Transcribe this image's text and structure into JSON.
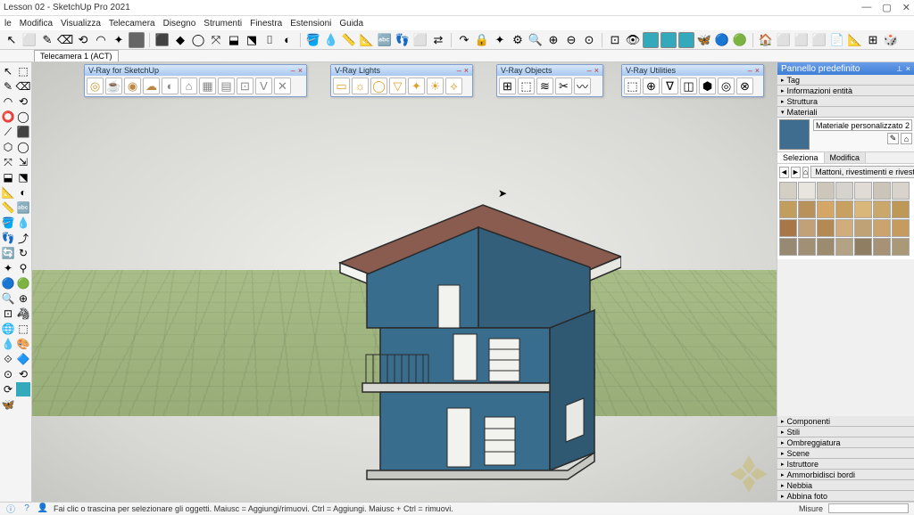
{
  "title": "Lesson 02 - SketchUp Pro 2021",
  "win_controls": {
    "min": "—",
    "max": "▢",
    "close": "✕"
  },
  "menu": [
    "le",
    "Modifica",
    "Visualizza",
    "Telecamera",
    "Disegno",
    "Strumenti",
    "Finestra",
    "Estensioni",
    "Guida"
  ],
  "scene_tab": "Telecamera 1 (ACT)",
  "status": {
    "msg": "Fai clic o trascina per selezionare gli oggetti. Maiusc = Aggiungi/rimuovi. Ctrl = Aggiungi. Maiusc + Ctrl = rimuovi.",
    "measure_label": "Misure"
  },
  "toolbox": {
    "vray_sketchup": {
      "title": "V-Ray for SketchUp"
    },
    "vray_lights": {
      "title": "V-Ray Lights"
    },
    "vray_objects": {
      "title": "V-Ray Objects"
    },
    "vray_utilities": {
      "title": "V-Ray Utilities"
    }
  },
  "right": {
    "pannello": "Pannello predefinito",
    "trays": {
      "tag": "Tag",
      "info": "Informazioni entità",
      "struttura": "Struttura",
      "materiali": "Materiali",
      "componenti": "Componenti",
      "stili": "Stili",
      "ombre": "Ombreggiatura",
      "scene": "Scene",
      "istruttore": "Istruttore",
      "ammorbidisci": "Ammorbidisci bordi",
      "nebbia": "Nebbia",
      "abbina": "Abbina foto"
    },
    "material_name": "Materiale personalizzato 2",
    "tabs": {
      "seleziona": "Seleziona",
      "modifica": "Modifica"
    },
    "collection": "Mattoni, rivestimenti e rivestime",
    "swatches": [
      "#d4cfc4",
      "#e8e5df",
      "#cdc6bb",
      "#d6d3ce",
      "#e0dcd5",
      "#cac4b9",
      "#d9d4cb",
      "#c19d5e",
      "#b8925a",
      "#d4a767",
      "#c8a060",
      "#d9b679",
      "#caa86c",
      "#bd9856",
      "#a87748",
      "#c2a178",
      "#b38954",
      "#d0ad7a",
      "#bfa275",
      "#cba36c",
      "#c69b60",
      "#988972",
      "#a29074",
      "#9c8b6f",
      "#b3a284",
      "#8f7e62",
      "#a59277",
      "#aa9978"
    ]
  },
  "main_tools": [
    "↖",
    "⬜",
    "✎",
    "⌫",
    "⟲",
    "◠",
    "✦",
    "#666",
    "⬛",
    "◆",
    "◯",
    "⤧",
    "⬓",
    "⬔",
    "⌷",
    "◐",
    "🪣",
    "💧",
    "📏",
    "📐",
    "🔤",
    "👣",
    "⬜",
    "⇄",
    "↷",
    "🔒",
    "✦",
    "⚙",
    "🔍",
    "⊕",
    "⊖",
    "⊙",
    "⊡",
    "👁",
    "#3ab",
    "#3ab",
    "#3ab",
    "🦋",
    "🔵",
    "🟢",
    "🏠",
    "⬜",
    "⬜",
    "⬜",
    "📄",
    "📐",
    "⊞",
    "🎲"
  ],
  "left_tools": [
    "↖",
    "⬚",
    "✎",
    "⌫",
    "◠",
    "⟲",
    "⭕",
    "◯",
    "⟋",
    "⬛",
    "⬡",
    "◯",
    "⤧",
    "⇲",
    "⬓",
    "⬔",
    "📐",
    "◐",
    "📏",
    "🔤",
    "🪣",
    "💧",
    "👣",
    "⤴",
    "🔄",
    "↻",
    "✦",
    "⚲",
    "🔵",
    "🟢",
    "🔍",
    "⊕",
    "⊡",
    "🦓",
    "🌐",
    "⬚",
    "💧",
    "🎨",
    "⟐",
    "🔷",
    "⊙",
    "⟲",
    "⟳",
    "#3ab",
    "🦋"
  ]
}
